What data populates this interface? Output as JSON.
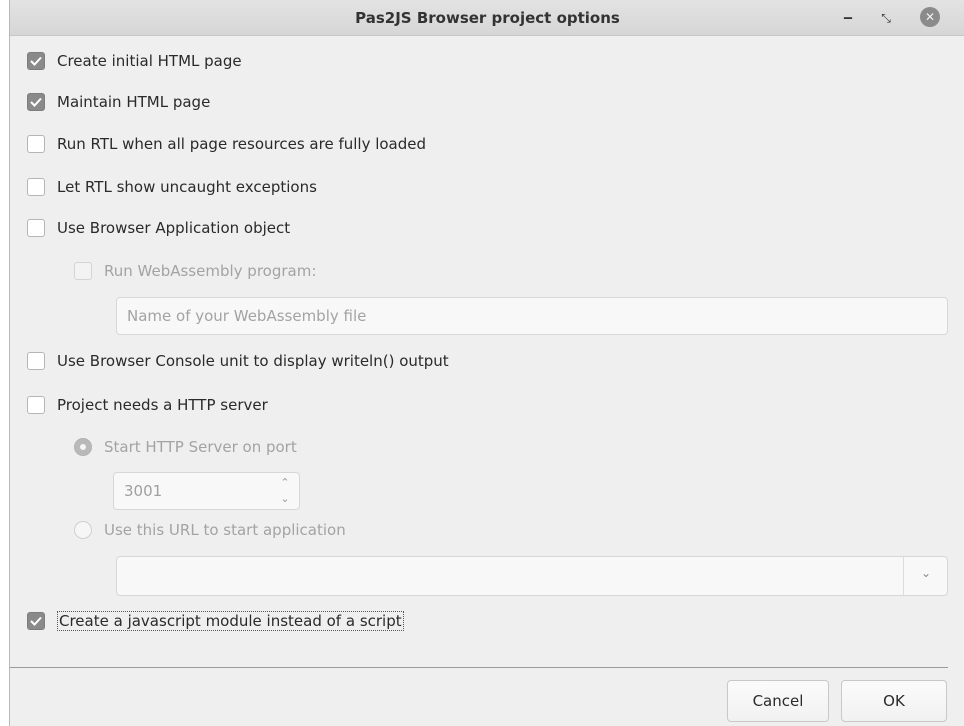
{
  "window": {
    "title": "Pas2JS Browser project options",
    "minimize_glyph": "‒",
    "maximize_glyph": "⤡",
    "close_glyph": "✕"
  },
  "options": {
    "create_initial_html": {
      "label": "Create initial HTML page",
      "checked": true
    },
    "maintain_html": {
      "label": "Maintain HTML page",
      "checked": true
    },
    "run_rtl_loaded": {
      "label": "Run RTL when all page resources are fully loaded",
      "checked": false
    },
    "rtl_exceptions": {
      "label": "Let RTL show uncaught exceptions",
      "checked": false
    },
    "browser_app_object": {
      "label": "Use Browser Application object",
      "checked": false
    },
    "run_wasm": {
      "label": "Run WebAssembly program:",
      "checked": false,
      "disabled": true
    },
    "wasm_file": {
      "placeholder": "Name of your WebAssembly file",
      "value": ""
    },
    "browser_console": {
      "label": "Use Browser Console unit to display writeln() output",
      "checked": false
    },
    "http_server": {
      "label": "Project needs a HTTP server",
      "checked": false
    },
    "start_server_radio": {
      "label": "Start HTTP Server on port",
      "selected": true,
      "disabled": true
    },
    "port": {
      "value": "3001",
      "up_glyph": "⌃",
      "down_glyph": "⌄"
    },
    "use_url_radio": {
      "label": "Use this URL to start application",
      "selected": false,
      "disabled": true
    },
    "url_combo": {
      "value": "",
      "arrow_glyph": "⌄"
    },
    "js_module": {
      "label": "Create a javascript module instead of a script",
      "checked": true
    }
  },
  "buttons": {
    "cancel": "Cancel",
    "ok": "OK"
  },
  "icons": {
    "check": "check-icon",
    "close": "close-icon"
  },
  "colors": {
    "checked_box": "#8a8a8a",
    "window_bg": "#efefef"
  }
}
